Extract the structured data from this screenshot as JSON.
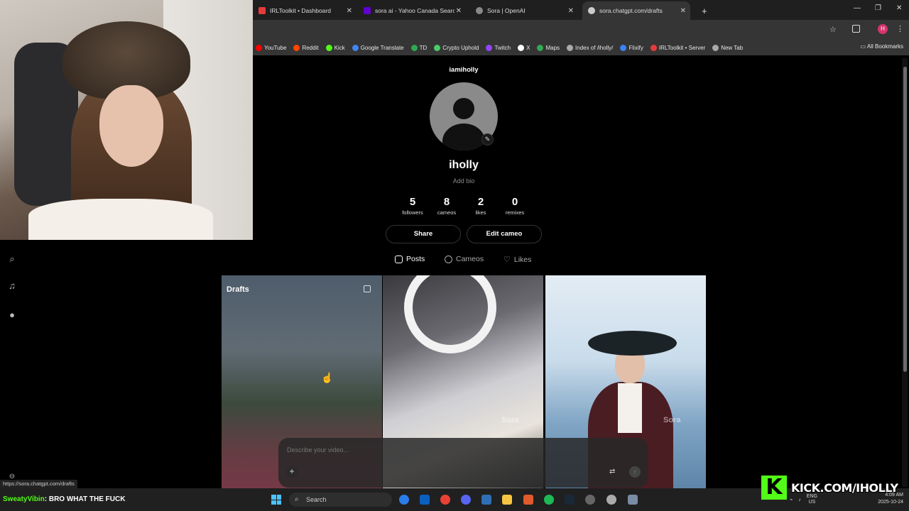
{
  "browser": {
    "tabs": [
      {
        "label": "IRLToolkit • Dashboard",
        "color": "#e63b3b"
      },
      {
        "label": "sora ai - Yahoo Canada Search",
        "color": "#6001d2"
      },
      {
        "label": "Sora | OpenAI",
        "color": "#888888"
      },
      {
        "label": "sora.chatgpt.com/drafts",
        "color": "#cccccc"
      }
    ],
    "new_tab": "+",
    "bookmarks": [
      {
        "label": "YouTube",
        "color": "#ff0000"
      },
      {
        "label": "Reddit",
        "color": "#ff4500"
      },
      {
        "label": "Kick",
        "color": "#53fc18"
      },
      {
        "label": "Google Translate",
        "color": "#4285f4"
      },
      {
        "label": "TD",
        "color": "#2fa84f"
      },
      {
        "label": "Crypto Uphold",
        "color": "#49cc68"
      },
      {
        "label": "Twitch",
        "color": "#9146ff"
      },
      {
        "label": "X",
        "color": "#ffffff"
      },
      {
        "label": "Maps",
        "color": "#34a853"
      },
      {
        "label": "Index of /iholly/",
        "color": "#aaaaaa"
      },
      {
        "label": "Flixify",
        "color": "#3b82f6"
      },
      {
        "label": "IRLToolkit • Server",
        "color": "#e63b3b"
      },
      {
        "label": "New Tab",
        "color": "#aaaaaa"
      }
    ],
    "all_bookmarks": "All Bookmarks",
    "profile_initial": "H",
    "status_url": "https://sora.chatgpt.com/drafts"
  },
  "profile": {
    "handle": "iamiholly",
    "display_name": "iholly",
    "add_bio": "Add bio",
    "stats": [
      {
        "value": "5",
        "label": "followers"
      },
      {
        "value": "8",
        "label": "cameos"
      },
      {
        "value": "2",
        "label": "likes"
      },
      {
        "value": "0",
        "label": "remixes"
      }
    ],
    "share_label": "Share",
    "edit_cameo_label": "Edit cameo",
    "tabs": [
      {
        "label": "Posts",
        "active": true
      },
      {
        "label": "Cameos",
        "active": false
      },
      {
        "label": "Likes",
        "active": false
      }
    ]
  },
  "grid": {
    "drafts_label": "Drafts",
    "watermark": "Sora"
  },
  "composer": {
    "placeholder": "Describe your video..."
  },
  "taskbar": {
    "chat_user": "SweatyVibin",
    "chat_message": ": BRO WHAT THE FUCK",
    "search_label": "Search",
    "lang_top": "ENG",
    "lang_bottom": "US",
    "time": "4:09 AM",
    "date": "2025-10-24"
  },
  "overlay": {
    "kick_logo": "K",
    "kick_url": "KICK.COM/IHOLLY"
  }
}
